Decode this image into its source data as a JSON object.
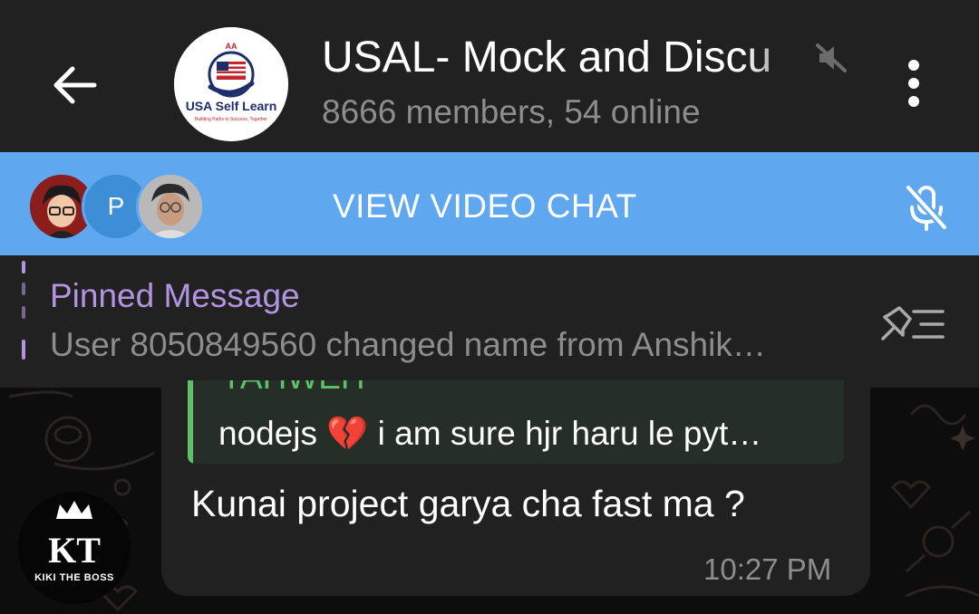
{
  "header": {
    "title": "USAL- Mock and Discu",
    "subtitle": "8666 members, 54 online",
    "avatar_logo_text": "USA Self Learn",
    "avatar_logo_tagline": "Building Paths to Success, Together",
    "avatar_logo_top": "AA",
    "icons": {
      "back": "arrow-left-icon",
      "muted": "muted-speaker-icon",
      "menu": "kebab-menu-icon"
    }
  },
  "video_chat": {
    "label": "VIEW VIDEO CHAT",
    "participants": [
      "avatar-cartoon",
      "P",
      "avatar-photo"
    ],
    "icons": {
      "mic": "mic-off-icon"
    },
    "bar_color": "#5fa8ef"
  },
  "pinned": {
    "title": "Pinned Message",
    "text": "User 8050849560 changed name from Anshik…",
    "accent_color": "#b294e0",
    "icons": {
      "list": "pinned-list-icon"
    }
  },
  "message": {
    "reply_name": "YAHWEH",
    "reply_text": "nodejs 💔  i am sure hjr haru le pyt…",
    "text": "Kunai project garya cha fast ma ?",
    "time": "10:27 PM",
    "sender_avatar_initials": "KT",
    "sender_avatar_caption": "KIKI THE BOSS",
    "reply_accent_color": "#5ec16a"
  }
}
